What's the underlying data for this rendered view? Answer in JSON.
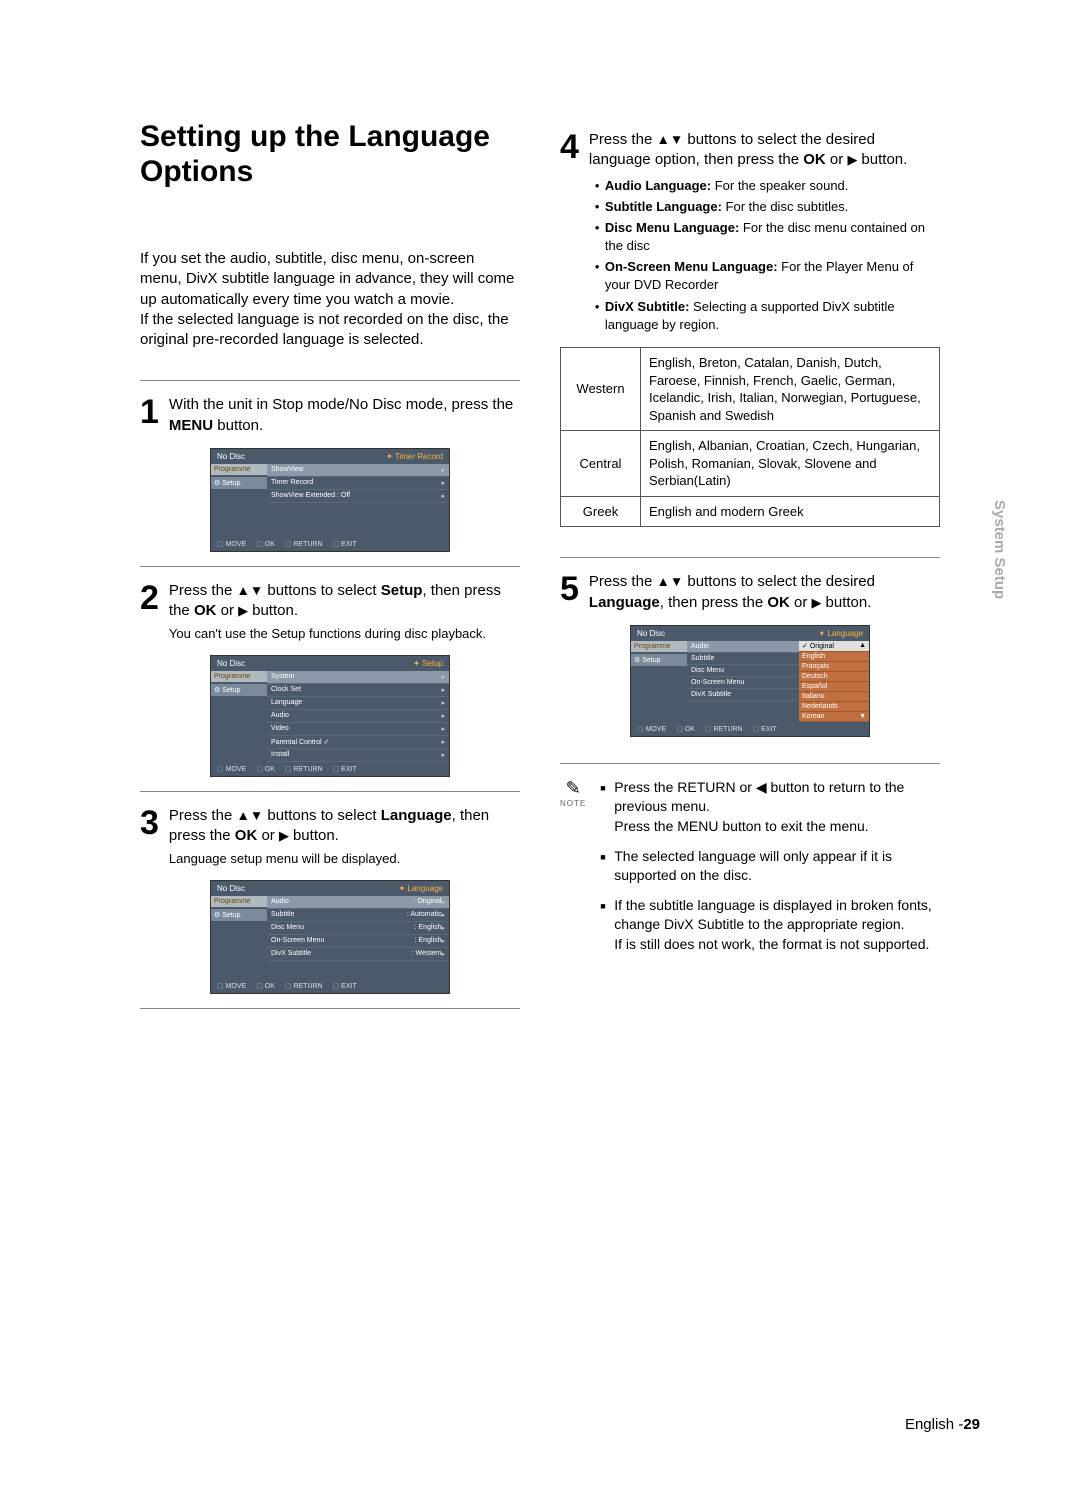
{
  "title": "Setting up the Language Options",
  "sideTab": "System Setup",
  "intro1": "If you set the audio, subtitle, disc menu, on-screen menu, DivX subtitle language in advance, they will come up automatically every time you watch a movie.",
  "intro2": "If the selected language is not recorded on the disc, the original pre-recorded language is selected.",
  "steps": {
    "s1": {
      "num": "1",
      "text_a": "With the unit in Stop mode/No Disc mode, press the ",
      "bold": "MENU",
      "text_b": " button."
    },
    "s2": {
      "num": "2",
      "l1": "Press the ▲▼ buttons to select Setup, then press the OK or ▶ button.",
      "sub": "You can't use the Setup functions during disc playback."
    },
    "s3": {
      "num": "3",
      "l1": "Press the ▲▼ buttons to select Language, then press the OK or ▶ button.",
      "sub": "Language setup menu will be displayed."
    },
    "s4": {
      "num": "4",
      "l1": "Press the ▲▼ buttons to select the desired language option, then press the OK or ▶ button."
    },
    "s5": {
      "num": "5",
      "l1": "Press the ▲▼ buttons to select the desired Language, then press the OK or ▶ button."
    }
  },
  "bullets4": [
    {
      "b": "Audio Language:",
      "t": " For the speaker sound."
    },
    {
      "b": "Subtitle Language:",
      "t": " For the disc subtitles."
    },
    {
      "b": "Disc Menu Language:",
      "t": " For the disc menu contained on the disc"
    },
    {
      "b": "On-Screen Menu Language:",
      "t": " For the Player Menu of your DVD Recorder"
    },
    {
      "b": "DivX Subtitle:",
      "t": " Selecting a supported DivX subtitle language by region."
    }
  ],
  "regions": [
    {
      "name": "Western",
      "langs": "English, Breton, Catalan, Danish, Dutch, Faroese, Finnish, French, Gaelic, German, Icelandic, Irish, Italian, Norwegian, Portuguese, Spanish and Swedish"
    },
    {
      "name": "Central",
      "langs": "English, Albanian, Croatian, Czech, Hungarian, Polish, Romanian, Slovak, Slovene and Serbian(Latin)"
    },
    {
      "name": "Greek",
      "langs": "English and modern Greek"
    }
  ],
  "notes": [
    "Press the RETURN or ◀ button to return to the previous menu.\nPress the MENU button to exit the menu.",
    "The selected language will only appear if it is supported on the disc.",
    "If the subtitle language is displayed in broken fonts, change DivX Subtitle to the appropriate region.\nIf is still does not work, the format is not supported."
  ],
  "noteIcon": "✎",
  "noteLabel": "NOTE",
  "osd": {
    "noDisc": "No Disc",
    "side1": "Programme",
    "side2": "Setup",
    "foot": {
      "move": "MOVE",
      "ok": "OK",
      "ret": "RETURN",
      "exit": "EXIT"
    },
    "s1": {
      "crumb": "Timer Record",
      "rows": [
        "ShowView",
        "Timer Record",
        "ShowView Extended : Off"
      ]
    },
    "s2": {
      "crumb": "Setup",
      "rows": [
        "System",
        "Clock Set",
        "Language",
        "Audio",
        "Video",
        "Parental Control ✓",
        "Install"
      ]
    },
    "s3": {
      "crumb": "Language",
      "rows": [
        {
          "k": "Audio",
          "v": ": Original"
        },
        {
          "k": "Subtitle",
          "v": ": Automatic"
        },
        {
          "k": "Disc Menu",
          "v": ": English"
        },
        {
          "k": "On-Screen Menu",
          "v": ": English"
        },
        {
          "k": "DivX Subtitle",
          "v": ": Western"
        }
      ]
    },
    "s5": {
      "crumb": "Language",
      "rows": [
        "Audio",
        "Subtitle",
        "Disc Menu",
        "On-Screen Menu",
        "DivX Subtitle"
      ],
      "opts": [
        "✓ Original",
        "English",
        "Français",
        "Deutsch",
        "Español",
        "Italiano",
        "Nederlands",
        "Korean"
      ]
    }
  },
  "footer": {
    "lang": "English -",
    "page": "29"
  }
}
